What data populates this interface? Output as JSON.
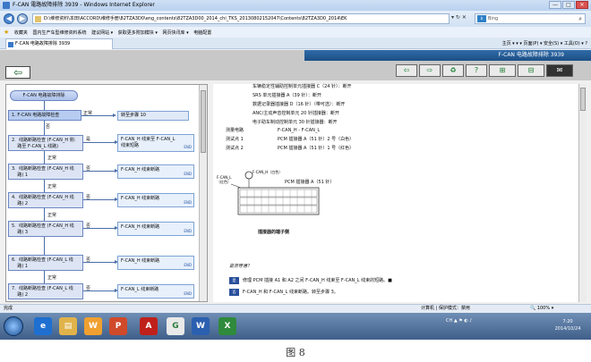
{
  "window": {
    "title": "F-CAN 電路故障排除 3939 - Windows Internet Explorer",
    "min": "—",
    "max": "□",
    "close": "✕"
  },
  "address": {
    "back": "◀",
    "forward": "▶",
    "url": "D:\\维修资料\\本田\\ACCORD\\维修手册\\82TZA3D0\\eng_contents\\82TZA3D00_2014_chi_TKS_20130802152047\\Contents\\82TZA3D0_2014\\EK",
    "tools": "▾ ↻ ✕",
    "search_placeholder": "Bing",
    "bing": "b"
  },
  "favorites": {
    "label": "收藏夹",
    "items": [
      "国内生产车型维修资料系统",
      "建议网站 ▾",
      "获取更多附加模块 ▾",
      "网页快讯库 ▾",
      "电脑配置"
    ]
  },
  "tab": {
    "label": "F-CAN 电路故障排除 3939"
  },
  "commandbar": "主页 ▾  ▾  ▾  页面(P) ▾  安全(S) ▾  工具(O) ▾  ?",
  "app": {
    "header_title": "F-CAN 电路故障排除 3939",
    "back_arrow": "⇦",
    "tools": [
      "⇦",
      "⇨",
      "♻",
      "?",
      "⊞",
      "⊟",
      "✉"
    ]
  },
  "flow": {
    "start": "F-CAN 电路故障排除",
    "steps": [
      {
        "label": "1.  F-CAN 电路故障检查"
      },
      {
        "label": "2.  线路断路检查 (F-CAN_H 侧:\n    路至 F-CAN_L 线路)"
      },
      {
        "label": "3.  线路断路检查 (F-CAN_H 线\n    路) 1"
      },
      {
        "label": "4.  线路断路检查 (F-CAN_H 线\n    路) 2"
      },
      {
        "label": "5.  线路断路检查 (F-CAN_H 线\n    路) 3"
      },
      {
        "label": "6.  线路断路检查 (F-CAN_L 线\n    路) 1"
      },
      {
        "label": "7.  线路断路检查 (F-CAN_L 线\n    路) 2"
      }
    ],
    "normal": "正常",
    "yes": "是",
    "no": "否",
    "to_step": "转至步骤 10",
    "results": [
      "F-CAN_H 线束至 F-CAN_L\n线束短路",
      "F-CAN_H 线束断路",
      "F-CAN_H 线束断路",
      "F-CAN_H 线束断路",
      "F-CAN_H 线束断路",
      "F-CAN_L 线束断路"
    ],
    "end": "END"
  },
  "content": {
    "conditions": [
      "车辆稳定性辅助控制单元插接器 C（24 针）：断开",
      "SRS 单元插接器 A（39 针）：断开",
      "数据记录器插接器 D（16 针）（带可选）：断开",
      "ANC/主动声音控制单元 20 针插接器：断开",
      "电子助车制动控制单元 30 针插接器：断开"
    ],
    "kv": [
      {
        "k": "测量电路",
        "v": "F-CAN_H - F-CAN_L"
      },
      {
        "k": "测试点 1",
        "v": "PCM 插接器 A（51 针）2 号（白色）"
      },
      {
        "k": "测试点 2",
        "v": "PCM 插接器 A（51 针）1 号（红色）"
      }
    ],
    "connector_title": "PCM 插接器 A（51 针）",
    "wire_label_left": "F-CAN_L\n（红色）",
    "wire_label_top": "F-CAN_H（白色）",
    "connector_footer": "插接器的端子侧",
    "question": "是否导通？",
    "answers": [
      {
        "tag": "是",
        "text": "修理 PCM 插接 A1 和 A2 之间 F-CAN_H 线束至 F-CAN_L 线束的短路。■"
      },
      {
        "tag": "否",
        "text": "F-CAN_H 和 F-CAN_L 线束断路。转至步骤 3。"
      }
    ]
  },
  "status": {
    "done": "完成",
    "zone": "计算机 | 保护模式：禁用",
    "zoom": "🔍 100% ▾"
  },
  "taskbar": {
    "apps": [
      "e",
      "▤",
      "W",
      "P",
      "A",
      "G",
      "W",
      "X"
    ],
    "tray": "CH ▲ ⚑ ◐ ♪",
    "time": "7:20",
    "date": "2014/10/24"
  },
  "figure_caption": "图 8"
}
